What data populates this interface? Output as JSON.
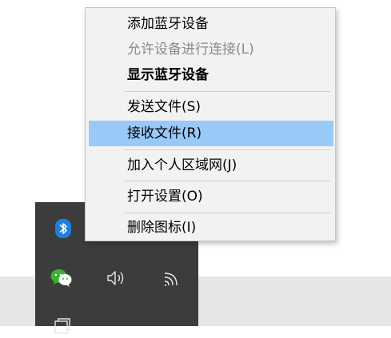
{
  "context_menu": {
    "items": [
      {
        "label": "添加蓝牙设备",
        "state": "normal"
      },
      {
        "label": "允许设备进行连接(L)",
        "state": "disabled"
      },
      {
        "label": "显示蓝牙设备",
        "state": "bold"
      },
      {
        "label": "发送文件(S)",
        "state": "normal"
      },
      {
        "label": "接收文件(R)",
        "state": "highlighted"
      },
      {
        "label": "加入个人区域网(J)",
        "state": "normal"
      },
      {
        "label": "打开设置(O)",
        "state": "normal"
      },
      {
        "label": "删除图标(I)",
        "state": "normal"
      }
    ],
    "highlight_color": "#99c9f6"
  },
  "tray": {
    "icons": [
      "bluetooth-icon",
      "wechat-icon",
      "volume-icon",
      "network-icon",
      "window-icon"
    ]
  },
  "colors": {
    "menu_bg": "#f2f2f2",
    "tray_bg": "#3c3c3c",
    "taskbar_bg": "#e6e6e6",
    "bluetooth": "#1e7fe0",
    "wechat": "#3cb034"
  }
}
